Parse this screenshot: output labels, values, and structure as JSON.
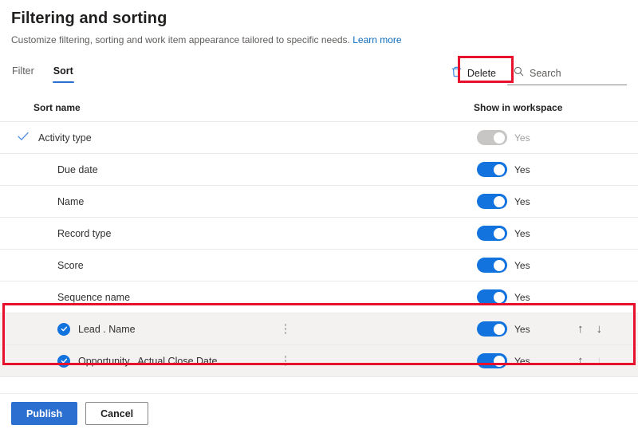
{
  "header": {
    "title": "Filtering and sorting",
    "subtitle": "Customize filtering, sorting and work item appearance tailored to specific needs.",
    "learn_more": "Learn more"
  },
  "tabs": [
    {
      "label": "Filter",
      "active": false
    },
    {
      "label": "Sort",
      "active": true
    }
  ],
  "commands": {
    "delete_label": "Delete",
    "delete_icon": "trash-icon",
    "search_icon": "search-icon",
    "search_placeholder": "Search",
    "search_value": ""
  },
  "table": {
    "columns": {
      "sort_name": "Sort name",
      "show_in_workspace": "Show in workspace"
    },
    "rows": [
      {
        "name": "Activity type",
        "selected": false,
        "checkmark": true,
        "toggle_on": false,
        "toggle_label": "Yes",
        "has_menu": false,
        "has_arrows": false,
        "up_disabled": false,
        "down_disabled": false
      },
      {
        "name": "Due date",
        "selected": false,
        "checkmark": false,
        "toggle_on": true,
        "toggle_label": "Yes",
        "has_menu": false,
        "has_arrows": false,
        "up_disabled": false,
        "down_disabled": false
      },
      {
        "name": "Name",
        "selected": false,
        "checkmark": false,
        "toggle_on": true,
        "toggle_label": "Yes",
        "has_menu": false,
        "has_arrows": false,
        "up_disabled": false,
        "down_disabled": false
      },
      {
        "name": "Record type",
        "selected": false,
        "checkmark": false,
        "toggle_on": true,
        "toggle_label": "Yes",
        "has_menu": false,
        "has_arrows": false,
        "up_disabled": false,
        "down_disabled": false
      },
      {
        "name": "Score",
        "selected": false,
        "checkmark": false,
        "toggle_on": true,
        "toggle_label": "Yes",
        "has_menu": false,
        "has_arrows": false,
        "up_disabled": false,
        "down_disabled": false
      },
      {
        "name": "Sequence name",
        "selected": false,
        "checkmark": false,
        "toggle_on": true,
        "toggle_label": "Yes",
        "has_menu": false,
        "has_arrows": false,
        "up_disabled": false,
        "down_disabled": false
      },
      {
        "name": "Lead . Name",
        "selected": true,
        "checkmark": false,
        "toggle_on": true,
        "toggle_label": "Yes",
        "has_menu": true,
        "has_arrows": true,
        "up_disabled": false,
        "down_disabled": false
      },
      {
        "name": "Opportunity . Actual Close Date",
        "selected": true,
        "checkmark": false,
        "toggle_on": true,
        "toggle_label": "Yes",
        "has_menu": true,
        "has_arrows": true,
        "up_disabled": false,
        "down_disabled": true
      }
    ]
  },
  "footer": {
    "publish_label": "Publish",
    "cancel_label": "Cancel"
  },
  "highlights": {
    "delete_box": "red-highlight-delete",
    "rows_box": "red-highlight-selected-rows"
  },
  "colors": {
    "accent": "#2b6fd1",
    "toggle_on": "#1273de",
    "toggle_off": "#c8c6c4",
    "link": "#0f6cbd",
    "highlight": "#e8112d",
    "selected_row_bg": "#f3f2f1"
  }
}
